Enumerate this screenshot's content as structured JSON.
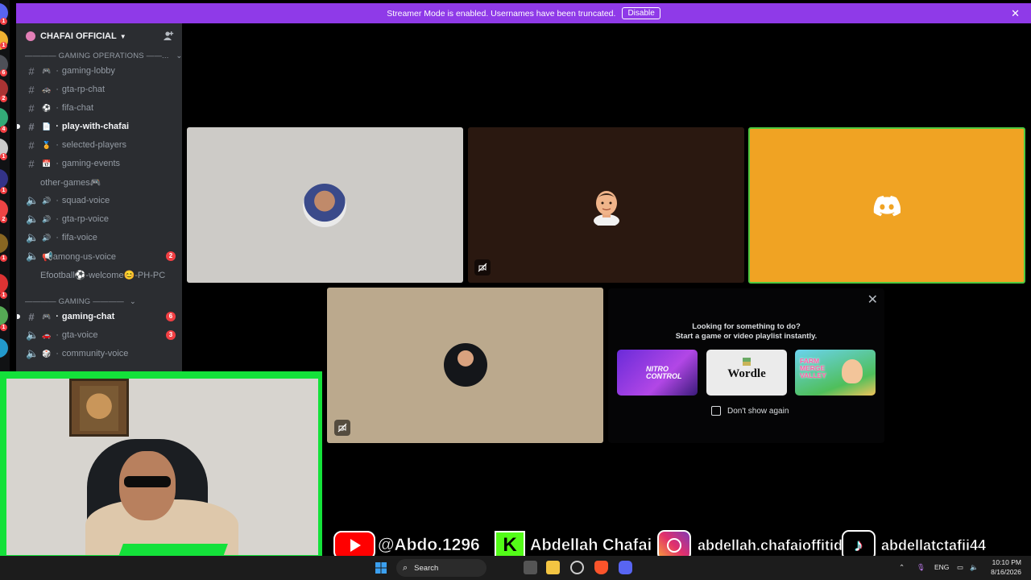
{
  "banner": {
    "text": "Streamer Mode is enabled. Usernames have been truncated.",
    "disable_label": "Disable"
  },
  "server": {
    "name": "CHAFAI OFFICIAL"
  },
  "categories": [
    {
      "label": "———— GAMING OPERATIONS ——..."
    },
    {
      "label": "———— GAMING ————"
    }
  ],
  "channels": [
    {
      "name": "gaming-lobby",
      "emoji": "🎮",
      "kind": "text"
    },
    {
      "name": "gta-rp-chat",
      "emoji": "🚓",
      "kind": "text"
    },
    {
      "name": "fifa-chat",
      "emoji": "⚽",
      "kind": "text"
    },
    {
      "name": "play-with-chafai",
      "emoji": "📄",
      "kind": "text",
      "active": true
    },
    {
      "name": "selected-players",
      "emoji": "🏅",
      "kind": "text"
    },
    {
      "name": "gaming-events",
      "emoji": "📅",
      "kind": "text"
    },
    {
      "name": "other-games🎮",
      "kind": "text"
    },
    {
      "name": "squad-voice",
      "emoji": "🔊",
      "kind": "voice"
    },
    {
      "name": "gta-rp-voice",
      "emoji": "🔊",
      "kind": "voice"
    },
    {
      "name": "fifa-voice",
      "emoji": "🔊",
      "kind": "voice"
    },
    {
      "name": "📢among-us-voice",
      "kind": "voice",
      "badge": "2"
    },
    {
      "name": "Efootball⚽-welcome😊-PH-PC",
      "kind": "voice"
    },
    {
      "name": "gaming-chat",
      "emoji": "🎮",
      "kind": "text",
      "active": true,
      "badge": "6"
    },
    {
      "name": "gta-voice",
      "emoji": "🚗",
      "kind": "voice",
      "badge": "3"
    },
    {
      "name": "community-voice",
      "emoji": "🎲",
      "kind": "voice"
    }
  ],
  "popup": {
    "line1": "Looking for something to do?",
    "line2": "Start a game or video playlist instantly.",
    "cards": [
      "NITRO CONTROL",
      "Wordle",
      "FARM MERGE VALLEY"
    ],
    "dont_show": "Don't show again"
  },
  "social": {
    "youtube": "@Abdo.1296",
    "kick": "Abdellah Chafai",
    "instagram": "abdellah.chafaioffitid",
    "tiktok": "abdellatctafii44"
  },
  "taskbar": {
    "search": "Search",
    "lang": "ENG",
    "time": "10:10 PM",
    "date": "8/16/2026"
  },
  "colors": {
    "banner": "#8f3ae8",
    "discord_tile": "#f0a323",
    "active_border": "#4ec940",
    "cam_frame": "#14e13a"
  }
}
